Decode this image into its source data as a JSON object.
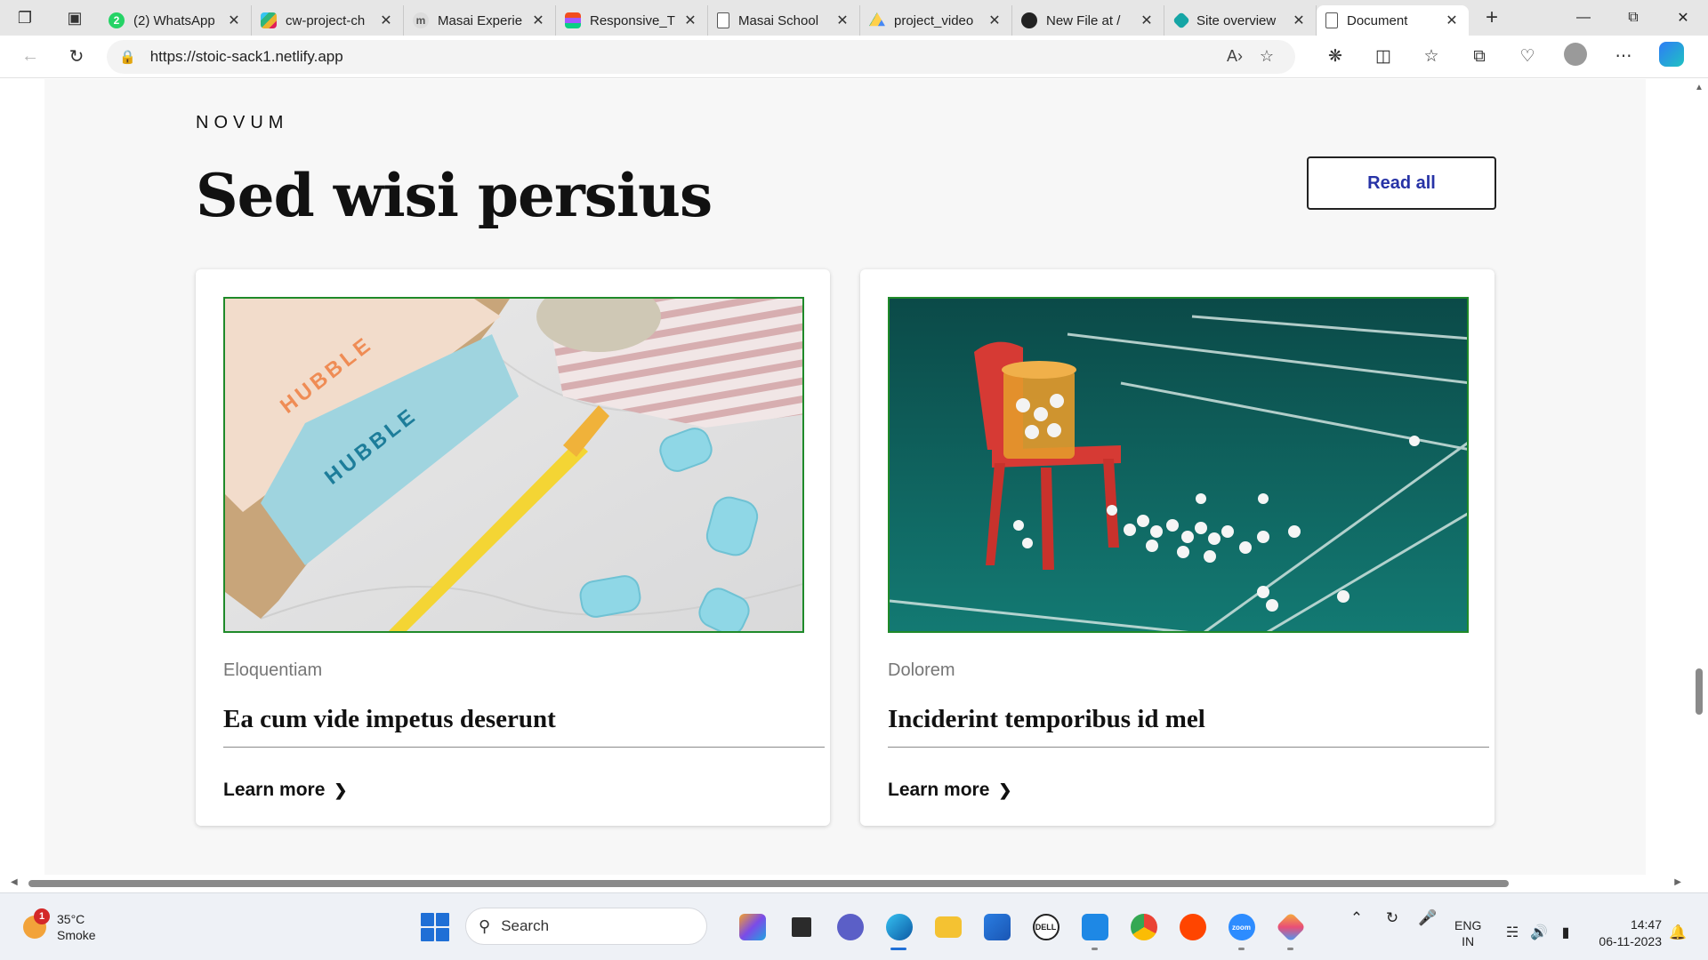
{
  "browser": {
    "tabs": [
      {
        "title": "(2) WhatsApp",
        "icon": "whatsapp-icon",
        "color": "#25d366"
      },
      {
        "title": "cw-project-ch",
        "icon": "slack-icon",
        "color": "#611f69"
      },
      {
        "title": "Masai Experie",
        "icon": "masai-icon",
        "color": "#9a9a9a"
      },
      {
        "title": "Responsive_T",
        "icon": "figma-icon",
        "color": "#f24e1e"
      },
      {
        "title": "Masai School",
        "icon": "document-icon",
        "color": "#ffffff"
      },
      {
        "title": "project_video",
        "icon": "google-drive-icon",
        "color": "#1fa463"
      },
      {
        "title": "New File at /",
        "icon": "github-icon",
        "color": "#222222"
      },
      {
        "title": "Site overview",
        "icon": "netlify-icon",
        "color": "#15a5a5"
      },
      {
        "title": "Document",
        "icon": "document-icon",
        "color": "#ffffff",
        "active": true
      }
    ],
    "url_host": "https://stoic-sack1.netlify.app"
  },
  "page": {
    "brand": "NOVUM",
    "headline": "Sed wisi persius",
    "read_all": "Read all",
    "cards": [
      {
        "category": "Eloquentiam",
        "title": "Ea cum vide impetus deserunt",
        "link": "Learn more",
        "image": "hubble contact lenses and yellow toothbrush"
      },
      {
        "category": "Dolorem",
        "title": "Inciderint temporibus id mel",
        "link": "Learn more",
        "image": "red chair with basket of shuttlecocks on badminton court"
      }
    ],
    "hubble_text": "HUBBLE"
  },
  "taskbar": {
    "weather_badge": "1",
    "temperature": "35°C",
    "condition": "Smoke",
    "search_placeholder": "Search",
    "language_line1": "ENG",
    "language_line2": "IN",
    "time": "14:47",
    "date": "06-11-2023",
    "zoom_label": "zoom"
  },
  "colors": {
    "accent_link": "#2733a6",
    "page_bg": "#f7f7f7",
    "image_border": "#1f8a2a",
    "court_green": "#0e6b66",
    "chair_red": "#d63a34"
  }
}
